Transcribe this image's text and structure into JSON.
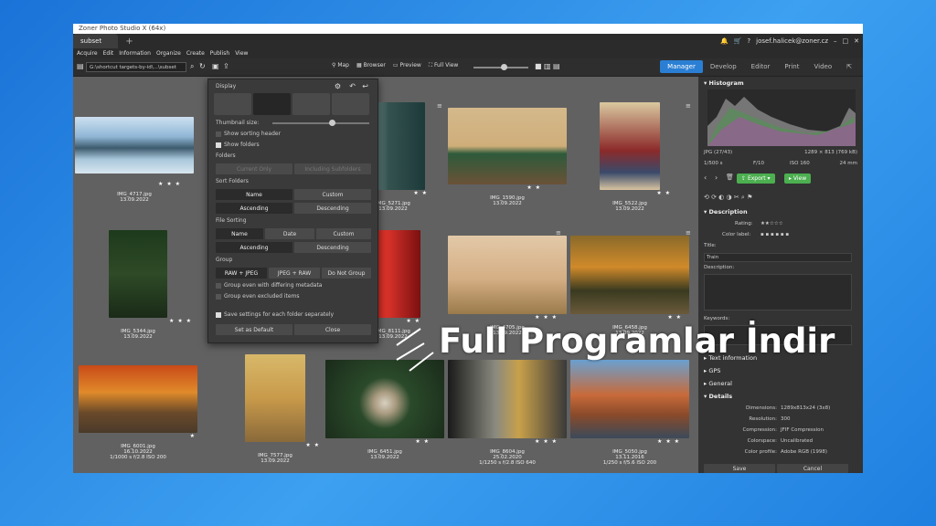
{
  "app": {
    "title": "Zoner Photo Studio X (64x)"
  },
  "tabs": [
    {
      "label": "subset"
    }
  ],
  "account": {
    "email": "josef.halicek@zoner.cz"
  },
  "menu": [
    "Acquire",
    "Edit",
    "Information",
    "Organize",
    "Create",
    "Publish",
    "View"
  ],
  "toolbar": {
    "path": "G:\\shortcut targets-by-id\\...\\subset",
    "map_label": "Map",
    "browser_label": "Browser",
    "preview_label": "Preview",
    "fullview_label": "Full View"
  },
  "modes": [
    "Manager",
    "Develop",
    "Editor",
    "Print",
    "Video"
  ],
  "active_mode": "Manager",
  "thumbnails": [
    {
      "name": "IMG_4717.jpg",
      "date": "13.09.2022",
      "stars": "★ ★ ★"
    },
    {
      "name": "IMG_5271.jpg",
      "date": "13.09.2022",
      "stars": "★ ★"
    },
    {
      "name": "IMG_1590.jpg",
      "date": "13.09.2022",
      "stars": "★ ★"
    },
    {
      "name": "IMG_5522.jpg",
      "date": "13.09.2022",
      "stars": "★ ★"
    },
    {
      "name": "IMG_5344.jpg",
      "date": "13.09.2022",
      "stars": "★ ★ ★"
    },
    {
      "name": "IMG_8111.jpg",
      "date": "13.09.2022",
      "stars": "★ ★"
    },
    {
      "name": "IMG_4705.jpg",
      "date": "13.09.2022",
      "stars": "★ ★ ★"
    },
    {
      "name": "IMG_6458.jpg",
      "date": "13.09.2022",
      "stars": "★ ★"
    },
    {
      "name": "IMG_6001.jpg",
      "date": "16.10.2022",
      "stars": "★",
      "meta": "1/1000 s   f/2.8   ISO 200"
    },
    {
      "name": "IMG_7577.jpg",
      "date": "13.09.2022",
      "stars": "★ ★"
    },
    {
      "name": "IMG_6451.jpg",
      "date": "13.09.2022",
      "stars": "★ ★"
    },
    {
      "name": "IMG_8604.jpg",
      "date": "25.02.2020",
      "stars": "★ ★ ★",
      "meta": "1/1250 s   f/2.8   ISO 640"
    },
    {
      "name": "IMG_5050.jpg",
      "date": "13.11.2016",
      "stars": "★ ★ ★",
      "meta": "1/250 s   f/5.6   ISO 200"
    }
  ],
  "display_popup": {
    "title": "Display",
    "thumbnail_size_label": "Thumbnail size:",
    "show_sorting_header": "Show sorting header",
    "show_folders": "Show folders",
    "folders_label": "Folders",
    "current_only": "Current Only",
    "including_subfolders": "Including Subfolders",
    "sort_folders_label": "Sort Folders",
    "sort_name": "Name",
    "sort_custom": "Custom",
    "ascending": "Ascending",
    "descending": "Descending",
    "file_sorting_label": "File Sorting",
    "fs_name": "Name",
    "fs_date": "Date",
    "fs_custom": "Custom",
    "group_label": "Group",
    "raw_jpeg": "RAW + JPEG",
    "jpeg_raw": "JPEG + RAW",
    "do_not_group": "Do Not Group",
    "group_metadata": "Group even with differing metadata",
    "group_excluded": "Group even excluded items",
    "save_settings": "Save settings for each folder separately",
    "set_default": "Set as Default",
    "close": "Close"
  },
  "right_panel": {
    "histogram_label": "Histogram",
    "file_type": "JPG (27/43)",
    "dims": "1289 × 813 (769 kB)",
    "shutter": "1/500 s",
    "fstop": "F/10",
    "iso": "ISO 160",
    "focal": "24 mm",
    "export_label": "Export",
    "view_label": "View",
    "description_label": "Description",
    "rating_label": "Rating:",
    "color_label_label": "Color label:",
    "title_label": "Title:",
    "title_value": "Train",
    "description_field_label": "Description:",
    "keywords_label": "Keywords:",
    "text_information": "Text information",
    "gps": "GPS",
    "general": "General",
    "details": "Details",
    "details_rows": [
      {
        "k": "Dimensions:",
        "v": "1289x813x24 (3x8)"
      },
      {
        "k": "Resolution:",
        "v": "300"
      },
      {
        "k": "Compression:",
        "v": "JFIF Compression"
      },
      {
        "k": "Colorspace:",
        "v": "Uncalibrated"
      },
      {
        "k": "Color profile:",
        "v": "Adobe RGB (1998)"
      }
    ],
    "save": "Save",
    "cancel": "Cancel"
  },
  "watermark": "Full Programlar İndir"
}
